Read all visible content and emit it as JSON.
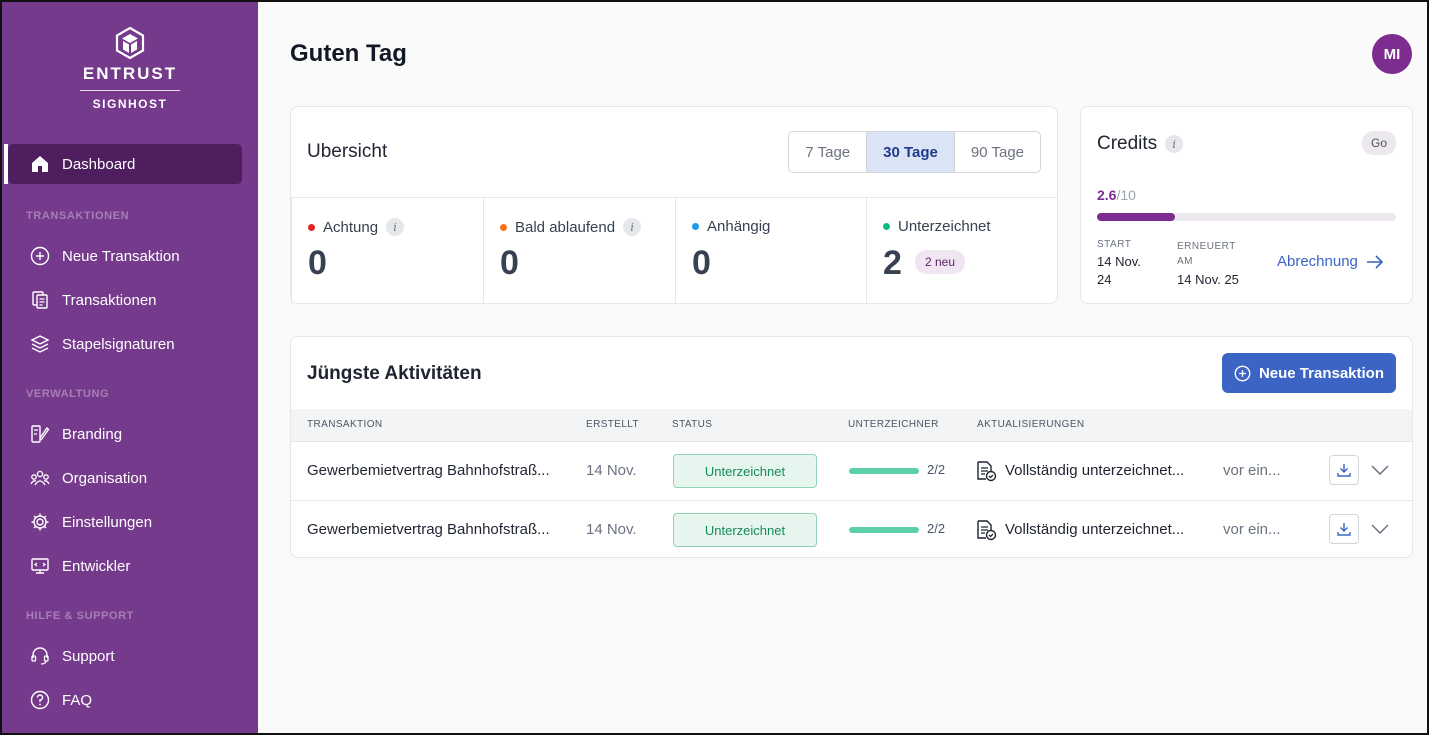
{
  "brand": {
    "name": "ENTRUST",
    "product": "SIGNHOST"
  },
  "sidebar": {
    "dashboard": "Dashboard",
    "sections": {
      "transactions": "TRANSAKTIONEN",
      "management": "VERWALTUNG",
      "help": "HILFE & SUPPORT"
    },
    "items": [
      {
        "label": "Neue Transaktion",
        "icon": "plus-circle-icon"
      },
      {
        "label": "Transaktionen",
        "icon": "documents-icon"
      },
      {
        "label": "Stapelsignaturen",
        "icon": "layers-icon"
      },
      {
        "label": "Branding",
        "icon": "branding-icon"
      },
      {
        "label": "Organisation",
        "icon": "organisation-icon"
      },
      {
        "label": "Einstellungen",
        "icon": "gear-icon"
      },
      {
        "label": "Entwickler",
        "icon": "developer-icon"
      },
      {
        "label": "Support",
        "icon": "headset-icon"
      },
      {
        "label": "FAQ",
        "icon": "question-icon"
      }
    ]
  },
  "header": {
    "title": "Guten Tag",
    "avatar": "MI"
  },
  "overview": {
    "title": "Ubersicht",
    "ranges": [
      "7 Tage",
      "30 Tage",
      "90 Tage"
    ],
    "active_range": "30 Tage",
    "stats": [
      {
        "label": "Achtung",
        "value": "0",
        "color": "#e02424"
      },
      {
        "label": "Bald ablaufend",
        "value": "0",
        "color": "#f97316"
      },
      {
        "label": "Anhängig",
        "value": "0",
        "color": "#1c9be6"
      },
      {
        "label": "Unterzeichnet",
        "value": "2",
        "color": "#10b981",
        "badge": "2 neu"
      }
    ]
  },
  "credits": {
    "title": "Credits",
    "go": "Go",
    "used": "2.6",
    "total": "/10",
    "fraction": 0.26,
    "start_label": "START",
    "start_line1": "14 Nov.",
    "start_line2": "24",
    "renewed_label_line1": "ERNEUERT",
    "renewed_label_line2": "AM",
    "renewed_value": "14 Nov. 25",
    "billing": "Abrechnung"
  },
  "activity": {
    "title": "Jüngste Aktivitäten",
    "new_button": "Neue Transaktion",
    "columns": [
      "TRANSAKTION",
      "ERSTELLT",
      "STATUS",
      "UNTERZEICHNER",
      "AKTUALISIERUNGEN"
    ],
    "rows": [
      {
        "transaction": "Gewerbemietvertrag Bahnhofstraß...",
        "created": "14 Nov.",
        "status": "Unterzeichnet",
        "signers": "2/2",
        "signed_fraction": 1.0,
        "update": "Vollständig unterzeichnet...",
        "time": "vor ein..."
      },
      {
        "transaction": "Gewerbemietvertrag Bahnhofstraß...",
        "created": "14 Nov.",
        "status": "Unterzeichnet",
        "signers": "2/2",
        "signed_fraction": 1.0,
        "update": "Vollständig unterzeichnet...",
        "time": "vor ein..."
      }
    ]
  }
}
